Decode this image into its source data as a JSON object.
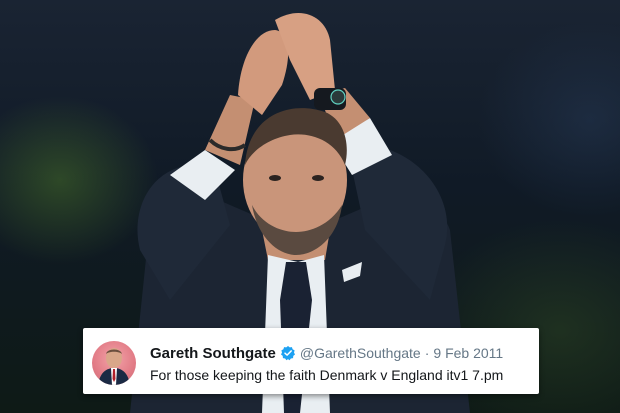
{
  "tweet": {
    "display_name": "Gareth Southgate",
    "verified_icon": "verified-badge-icon",
    "handle": "@GarethSouthgate",
    "separator": "·",
    "date": "9 Feb 2011",
    "text": "For those keeping the faith Denmark v England itv1 7.pm"
  },
  "colors": {
    "card_bg": "#ffffff",
    "name": "#14171a",
    "secondary": "#657786",
    "verified": "#1da1f2",
    "avatar_bg": "#e27b86"
  }
}
